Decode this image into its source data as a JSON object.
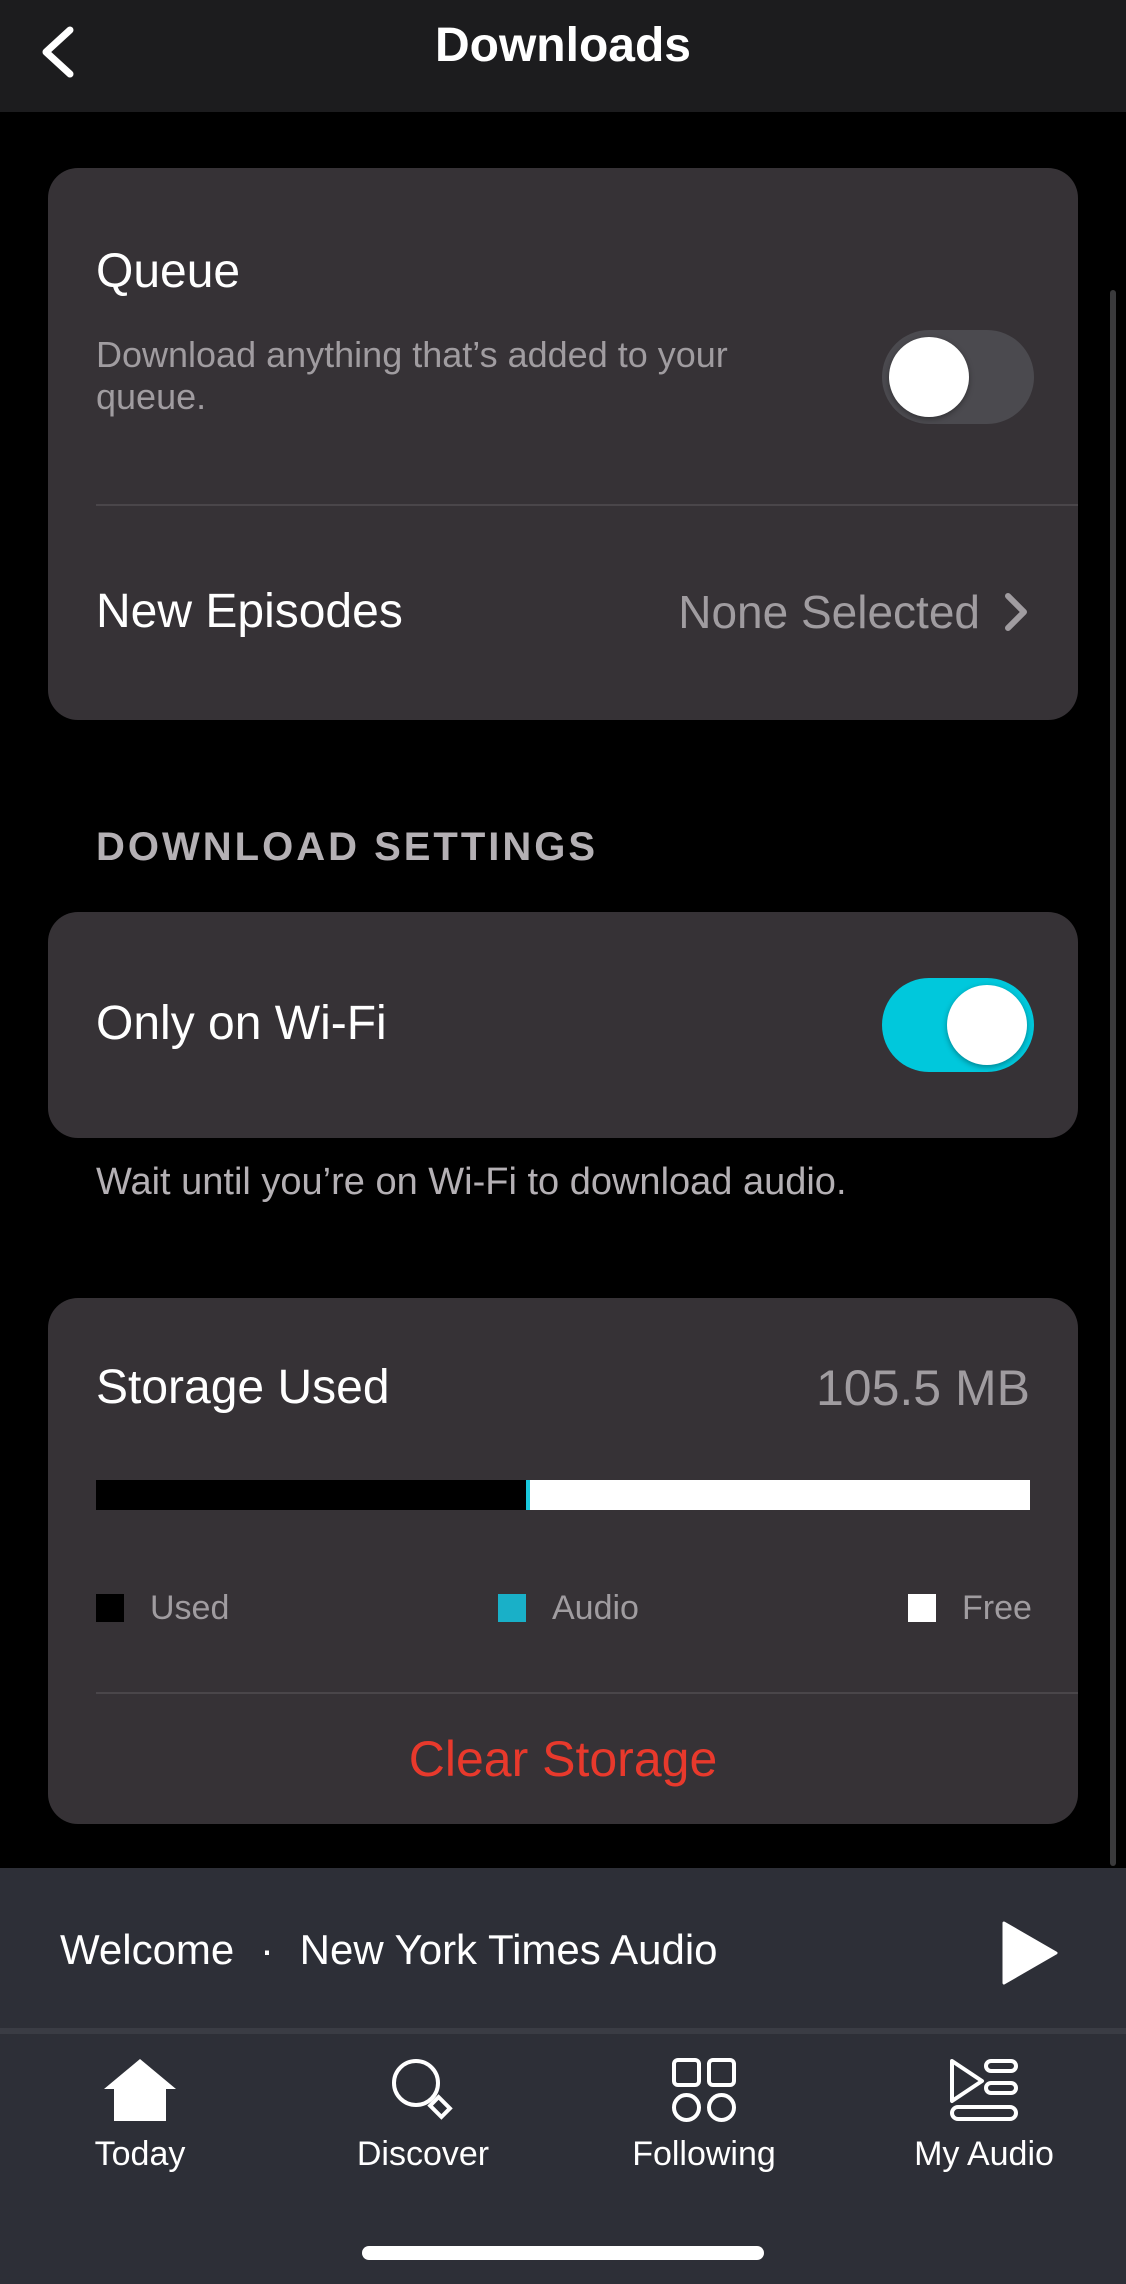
{
  "header": {
    "title": "Downloads",
    "back_icon": "chevron-left-icon"
  },
  "auto_download": {
    "queue": {
      "title": "Queue",
      "description": "Download anything that’s added to your queue.",
      "toggle_on": false
    },
    "new_episodes": {
      "title": "New Episodes",
      "value": "None Selected",
      "chevron_icon": "chevron-right-icon"
    }
  },
  "download_settings": {
    "header": "DOWNLOAD SETTINGS",
    "wifi": {
      "title": "Only on Wi-Fi",
      "toggle_on": true
    },
    "footer": "Wait until you’re on Wi-Fi to download audio."
  },
  "storage": {
    "title": "Storage Used",
    "value": "105.5 MB",
    "bar": {
      "used_fraction": 0.46,
      "audio_fraction": 0.005,
      "free_fraction": 0.535
    },
    "legend": [
      {
        "label": "Used",
        "color": "#000000"
      },
      {
        "label": "Audio",
        "color": "#19b0c8"
      },
      {
        "label": "Free",
        "color": "#ffffff"
      }
    ],
    "clear_label": "Clear Storage",
    "clear_color": "#e8392c"
  },
  "now_playing": {
    "title": "Welcome",
    "separator": "·",
    "source": "New York Times Audio",
    "play_icon": "play-icon"
  },
  "tabs": [
    {
      "label": "Today",
      "icon": "home-icon",
      "active": true
    },
    {
      "label": "Discover",
      "icon": "search-icon",
      "active": false
    },
    {
      "label": "Following",
      "icon": "grid-icon",
      "active": false
    },
    {
      "label": "My Audio",
      "icon": "library-icon",
      "active": false
    }
  ],
  "colors": {
    "accent": "#00c8dc",
    "card": "#363236",
    "background": "#000000",
    "destructive": "#e8392c"
  }
}
